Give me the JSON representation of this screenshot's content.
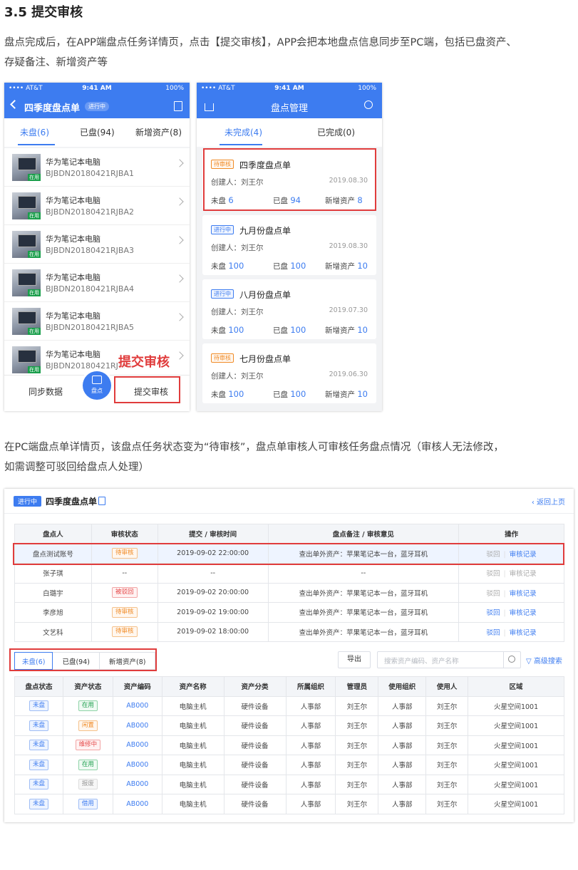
{
  "section_title": "3.5  提交审核",
  "para1_line1": "盘点完成后，在APP端盘点任务详情页，点击【提交审核】，APP会把本地盘点信息同步至PC端，包括已盘资产、",
  "para1_line2": "存疑备注、新增资产等",
  "para2_line1": "在PC端盘点单详情页，该盘点任务状态变为“待审核”，盘点单审核人可审核任务盘点情况（审核人无法修改，",
  "para2_line2": "如需调整可驳回给盘点人处理）",
  "status": {
    "carrier": "•••• AT&T",
    "time": "9:41 AM",
    "battery": "100%"
  },
  "phone1": {
    "title": "四季度盘点单",
    "badge": "进行中",
    "tabs": [
      "未盘(6)",
      "已盘(94)",
      "新增资产(8)"
    ],
    "items": [
      {
        "name": "华为笔记本电脑",
        "code": "BJBDN20180421RJBA1",
        "tag": "在用"
      },
      {
        "name": "华为笔记本电脑",
        "code": "BJBDN20180421RJBA2",
        "tag": "在用"
      },
      {
        "name": "华为笔记本电脑",
        "code": "BJBDN20180421RJBA3",
        "tag": "在用"
      },
      {
        "name": "华为笔记本电脑",
        "code": "BJBDN20180421RJBA4",
        "tag": "在用"
      },
      {
        "name": "华为笔记本电脑",
        "code": "BJBDN20180421RJBA5",
        "tag": "在用"
      },
      {
        "name": "华为笔记本电脑",
        "code": "BJBDN20180421RJBA6",
        "tag": "在用"
      }
    ],
    "sync_label": "同步数据",
    "scan_label": "盘点",
    "submit_label": "提交审核",
    "callout": "提交审核"
  },
  "phone2": {
    "title": "盘点管理",
    "tabs": [
      "未完成(4)",
      "已完成(0)"
    ],
    "cards": [
      {
        "badge": "待审核",
        "kind": "pending",
        "title": "四季度盘点单",
        "creator": "创建人：刘王尔",
        "date": "2019.08.30",
        "uncounted_label": "未盘",
        "uncounted": "6",
        "counted_label": "已盘",
        "counted": "94",
        "new_label": "新增资产",
        "new": "8"
      },
      {
        "badge": "进行中",
        "kind": "ongoing",
        "title": "九月份盘点单",
        "creator": "创建人：刘王尔",
        "date": "2019.08.30",
        "uncounted_label": "未盘",
        "uncounted": "100",
        "counted_label": "已盘",
        "counted": "100",
        "new_label": "新增资产",
        "new": "10"
      },
      {
        "badge": "进行中",
        "kind": "ongoing",
        "title": "八月份盘点单",
        "creator": "创建人：刘王尔",
        "date": "2019.07.30",
        "uncounted_label": "未盘",
        "uncounted": "100",
        "counted_label": "已盘",
        "counted": "100",
        "new_label": "新增资产",
        "new": "10"
      },
      {
        "badge": "待审核",
        "kind": "pending",
        "title": "七月份盘点单",
        "creator": "创建人：刘王尔",
        "date": "2019.06.30",
        "uncounted_label": "未盘",
        "uncounted": "100",
        "counted_label": "已盘",
        "counted": "100",
        "new_label": "新增资产",
        "new": "10"
      }
    ]
  },
  "pc": {
    "badge": "进行中",
    "title": "四季度盘点单",
    "back": "返回上页",
    "review_headers": [
      "盘点人",
      "审核状态",
      "提交 / 审核时间",
      "盘点备注 / 审核意见",
      "操作"
    ],
    "review_rows": [
      {
        "person": "盘点测试账号",
        "status": "待审核",
        "kind": "orange",
        "time": "2019-09-02 22:00:00",
        "note": "查出单外资产：苹果笔记本一台，蓝牙耳机",
        "reject": "驳回",
        "record": "审核记录",
        "reject_active": false,
        "record_active": true
      },
      {
        "person": "张子琪",
        "status": "--",
        "kind": "",
        "time": "--",
        "note": "--",
        "reject": "驳回",
        "record": "审核记录",
        "reject_active": false,
        "record_active": false
      },
      {
        "person": "白璐宇",
        "status": "被驳回",
        "kind": "red",
        "time": "2019-09-02 20:00:00",
        "note": "查出单外资产：苹果笔记本一台，蓝牙耳机",
        "reject": "驳回",
        "record": "审核记录",
        "reject_active": false,
        "record_active": true
      },
      {
        "person": "李彦旭",
        "status": "待审核",
        "kind": "orange",
        "time": "2019-09-02 19:00:00",
        "note": "查出单外资产：苹果笔记本一台，蓝牙耳机",
        "reject": "驳回",
        "record": "审核记录",
        "reject_active": true,
        "record_active": true
      },
      {
        "person": "文艺科",
        "status": "待审核",
        "kind": "orange",
        "time": "2019-09-02 18:00:00",
        "note": "查出单外资产：苹果笔记本一台，蓝牙耳机",
        "reject": "驳回",
        "record": "审核记录",
        "reject_active": true,
        "record_active": true
      }
    ],
    "tabs": [
      "未盘(6)",
      "已盘(94)",
      "新增资产(8)"
    ],
    "export_label": "导出",
    "search_placeholder": "搜索资产编码、资产名称",
    "advanced_search": "高级搜索",
    "asset_headers": [
      "盘点状态",
      "资产状态",
      "资产编码",
      "资产名称",
      "资产分类",
      "所属组织",
      "管理员",
      "使用组织",
      "使用人",
      "区域"
    ],
    "asset_rows": [
      {
        "count_status": "未盘",
        "asset_status": "在用",
        "kind": "green",
        "code": "AB000",
        "name": "电脑主机",
        "category": "硬件设备",
        "org": "人事部",
        "admin": "刘王尔",
        "use_org": "人事部",
        "user": "刘王尔",
        "area": "火星空间1001"
      },
      {
        "count_status": "未盘",
        "asset_status": "闲置",
        "kind": "orange",
        "code": "AB000",
        "name": "电脑主机",
        "category": "硬件设备",
        "org": "人事部",
        "admin": "刘王尔",
        "use_org": "人事部",
        "user": "刘王尔",
        "area": "火星空间1001"
      },
      {
        "count_status": "未盘",
        "asset_status": "维修中",
        "kind": "red",
        "code": "AB000",
        "name": "电脑主机",
        "category": "硬件设备",
        "org": "人事部",
        "admin": "刘王尔",
        "use_org": "人事部",
        "user": "刘王尔",
        "area": "火星空间1001"
      },
      {
        "count_status": "未盘",
        "asset_status": "在用",
        "kind": "green",
        "code": "AB000",
        "name": "电脑主机",
        "category": "硬件设备",
        "org": "人事部",
        "admin": "刘王尔",
        "use_org": "人事部",
        "user": "刘王尔",
        "area": "火星空间1001"
      },
      {
        "count_status": "未盘",
        "asset_status": "报废",
        "kind": "gray",
        "code": "AB000",
        "name": "电脑主机",
        "category": "硬件设备",
        "org": "人事部",
        "admin": "刘王尔",
        "use_org": "人事部",
        "user": "刘王尔",
        "area": "火星空间1001"
      },
      {
        "count_status": "未盘",
        "asset_status": "借用",
        "kind": "blue",
        "code": "AB000",
        "name": "电脑主机",
        "category": "硬件设备",
        "org": "人事部",
        "admin": "刘王尔",
        "use_org": "人事部",
        "user": "刘王尔",
        "area": "火星空间1001"
      }
    ]
  }
}
